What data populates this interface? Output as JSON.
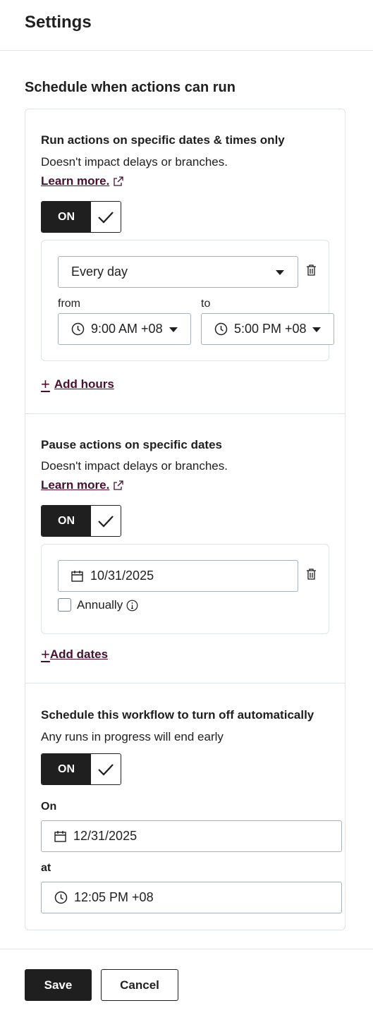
{
  "header": {
    "title": "Settings"
  },
  "section": {
    "title": "Schedule when actions can run"
  },
  "run_block": {
    "title": "Run actions on specific dates & times only",
    "description": "Doesn't impact delays or branches.",
    "learn_more": "Learn more.",
    "toggle_label": "ON",
    "frequency_value": "Every day",
    "from_label": "from",
    "to_label": "to",
    "from_time": "9:00 AM +08",
    "to_time": "5:00 PM +08",
    "add_hours": "Add hours"
  },
  "pause_block": {
    "title": "Pause actions on specific dates",
    "description": "Doesn't impact delays or branches.",
    "learn_more": "Learn more.",
    "toggle_label": "ON",
    "date_value": "10/31/2025",
    "annually_label": "Annually",
    "add_dates": "Add dates"
  },
  "turnoff_block": {
    "title": "Schedule this workflow to turn off automatically",
    "description": "Any runs in progress will end early",
    "toggle_label": "ON",
    "on_label": "On",
    "on_date": "12/31/2025",
    "at_label": "at",
    "at_time": "12:05 PM +08"
  },
  "footer": {
    "save_label": "Save",
    "cancel_label": "Cancel"
  },
  "colors": {
    "primary": "#1f1f1f",
    "link": "#4a0f2f",
    "border": "#dfe3eb"
  }
}
